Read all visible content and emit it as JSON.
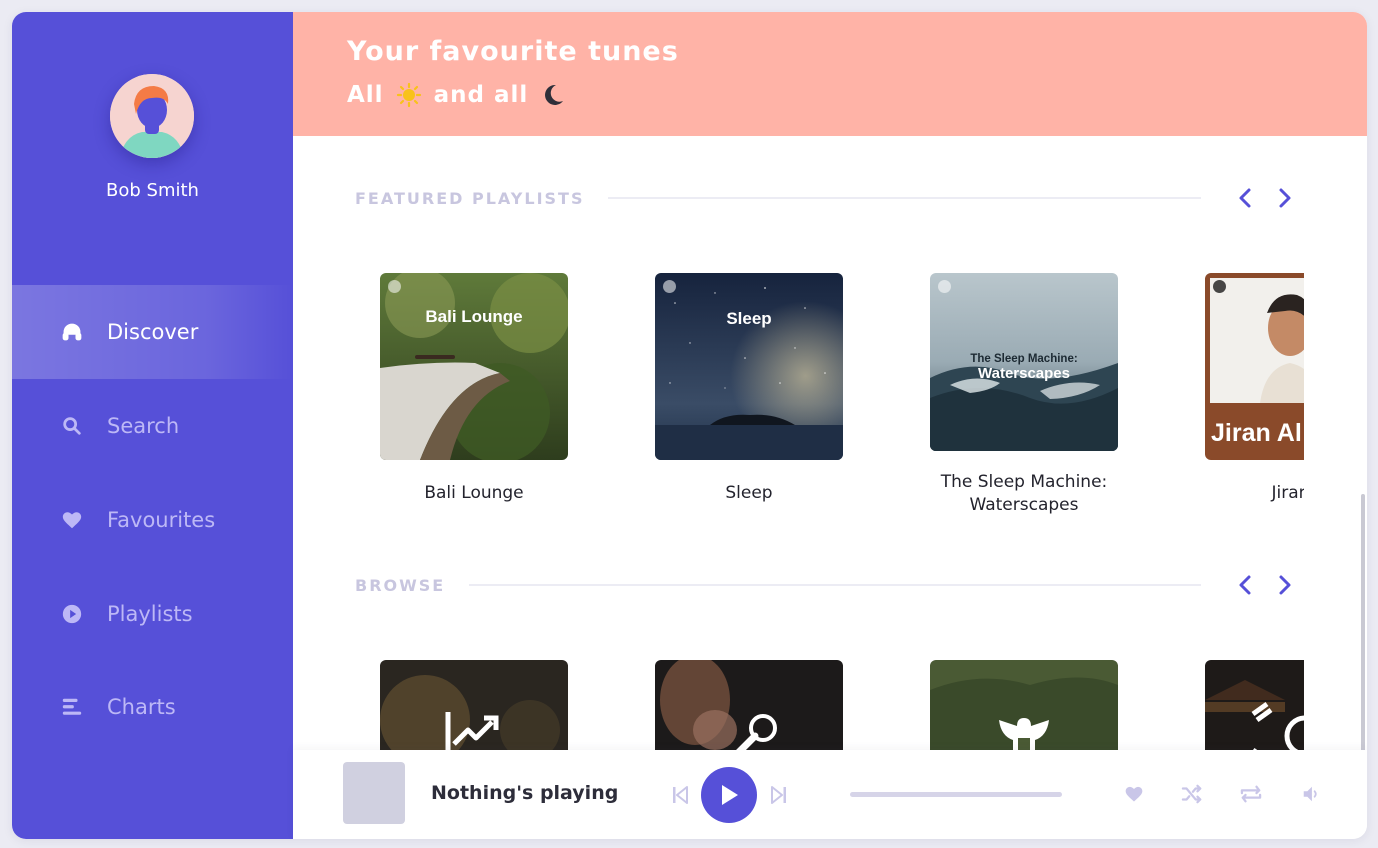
{
  "user": {
    "name": "Bob Smith"
  },
  "nav": {
    "items": [
      {
        "label": "Discover",
        "icon": "headphones-icon",
        "active": true
      },
      {
        "label": "Search",
        "icon": "search-icon",
        "active": false
      },
      {
        "label": "Favourites",
        "icon": "heart-icon",
        "active": false
      },
      {
        "label": "Playlists",
        "icon": "play-circle-icon",
        "active": false
      },
      {
        "label": "Charts",
        "icon": "bars-icon",
        "active": false
      }
    ]
  },
  "header": {
    "title": "Your favourite tunes",
    "subtitle_part1": "All",
    "subtitle_part2": "and all"
  },
  "featured": {
    "title": "FEATURED PLAYLISTS",
    "playlists": [
      {
        "name": "Bali Lounge",
        "cover_text": "Bali Lounge"
      },
      {
        "name": "Sleep",
        "cover_text": "Sleep"
      },
      {
        "name": "The Sleep Machine: Waterscapes",
        "cover_text_line1": "The Sleep Machine:",
        "cover_text_line2": "Waterscapes"
      },
      {
        "name": "Jiran A",
        "cover_text": "Jiran Al"
      }
    ]
  },
  "browse": {
    "title": "BROWSE",
    "categories": [
      {
        "icon": "trending-up-icon"
      },
      {
        "icon": "microphone-icon"
      },
      {
        "icon": "eagle-icon"
      },
      {
        "icon": "taegeuk-flag-icon"
      }
    ]
  },
  "player": {
    "status": "Nothing's playing",
    "progress": 0
  },
  "colors": {
    "primary": "#5650d8",
    "header": "#ffb3a7",
    "nav_inactive": "#bdb8f6",
    "control_muted": "#c9c6e8"
  }
}
